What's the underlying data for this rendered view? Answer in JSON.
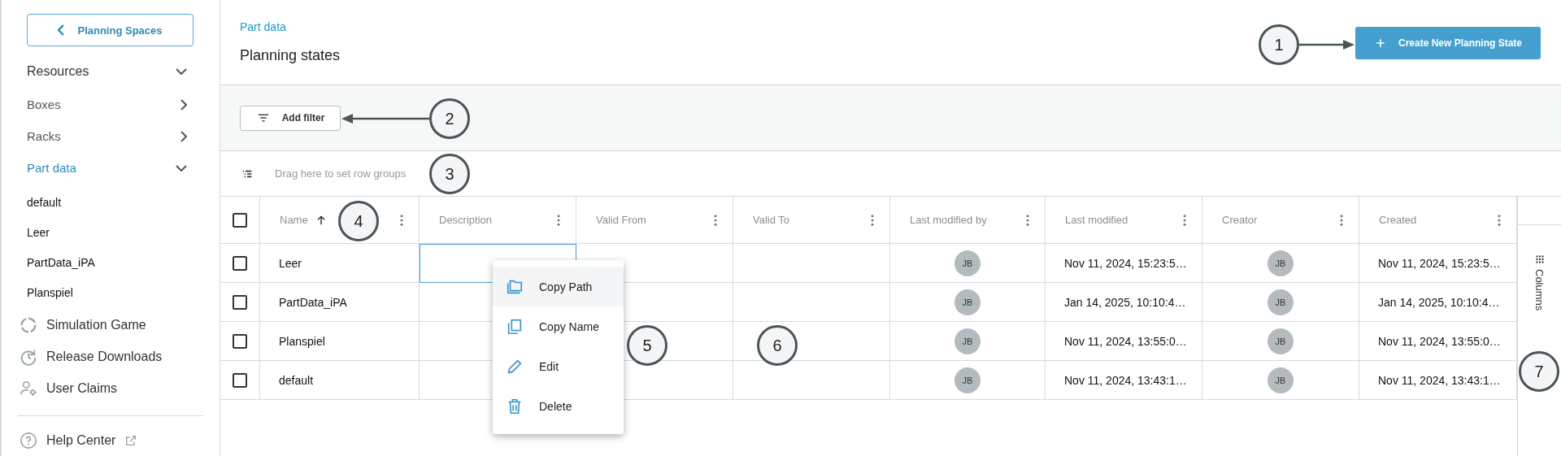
{
  "sidebar": {
    "back_button": "Planning Spaces",
    "nav": [
      {
        "label": "Resources",
        "expanded": true,
        "selected": false,
        "children": [
          {
            "label": "Boxes",
            "expanded": false,
            "selected": false
          },
          {
            "label": "Racks",
            "expanded": false,
            "selected": false
          },
          {
            "label": "Part data",
            "expanded": true,
            "selected": true,
            "children": [
              {
                "label": "default"
              },
              {
                "label": "Leer"
              },
              {
                "label": "PartData_iPA"
              },
              {
                "label": "Planspiel"
              }
            ]
          }
        ]
      }
    ],
    "links": [
      {
        "label": "Simulation Game"
      },
      {
        "label": "Release Downloads"
      },
      {
        "label": "User Claims"
      }
    ],
    "help": {
      "label": "Help Center"
    }
  },
  "header": {
    "breadcrumb": "Part data",
    "title": "Planning states",
    "create_button": "Create New Planning State"
  },
  "filter_bar": {
    "button": "Add filter"
  },
  "group_bar": {
    "placeholder": "Drag here to set row groups"
  },
  "table": {
    "select_all_checked": false,
    "columns": [
      {
        "label": "Name",
        "kind": "text",
        "sorted": true
      },
      {
        "label": "Description",
        "kind": "text",
        "sorted": false
      },
      {
        "label": "Valid From",
        "kind": "text",
        "sorted": false
      },
      {
        "label": "Valid To",
        "kind": "text",
        "sorted": false
      },
      {
        "label": "Last modified by",
        "kind": "avatar",
        "sorted": false
      },
      {
        "label": "Last modified",
        "kind": "text",
        "sorted": false
      },
      {
        "label": "Creator",
        "kind": "avatar",
        "sorted": false
      },
      {
        "label": "Created",
        "kind": "text",
        "sorted": false
      }
    ],
    "rows": [
      {
        "checked": false,
        "cells": [
          {
            "text": "Leer",
            "focused": false
          },
          {
            "focused": true
          },
          {
            "focused": false
          },
          {
            "focused": false
          },
          {
            "text": "JB",
            "focused": false
          },
          {
            "text": "Nov 11, 2024, 15:23:5…",
            "focused": false
          },
          {
            "text": "JB",
            "focused": false
          },
          {
            "text": "Nov 11, 2024, 15:23:5…",
            "focused": false
          }
        ]
      },
      {
        "checked": false,
        "cells": [
          {
            "text": "PartData_iPA",
            "focused": false
          },
          {
            "focused": false
          },
          {
            "focused": false
          },
          {
            "focused": false
          },
          {
            "text": "JB",
            "focused": false
          },
          {
            "text": "Jan 14, 2025, 10:10:4…",
            "focused": false
          },
          {
            "text": "JB",
            "focused": false
          },
          {
            "text": "Jan 14, 2025, 10:10:4…",
            "focused": false
          }
        ]
      },
      {
        "checked": false,
        "cells": [
          {
            "text": "Planspiel",
            "focused": false
          },
          {
            "focused": false
          },
          {
            "focused": false
          },
          {
            "focused": false
          },
          {
            "text": "JB",
            "focused": false
          },
          {
            "text": "Nov 11, 2024, 13:55:0…",
            "focused": false
          },
          {
            "text": "JB",
            "focused": false
          },
          {
            "text": "Nov 11, 2024, 13:55:0…",
            "focused": false
          }
        ]
      },
      {
        "checked": false,
        "cells": [
          {
            "text": "default",
            "focused": false
          },
          {
            "focused": false
          },
          {
            "focused": false
          },
          {
            "focused": false
          },
          {
            "text": "JB",
            "focused": false
          },
          {
            "text": "Nov 11, 2024, 13:43:1…",
            "focused": false
          },
          {
            "text": "JB",
            "focused": false
          },
          {
            "text": "Nov 11, 2024, 13:43:1…",
            "focused": false
          }
        ]
      }
    ]
  },
  "side_panel": {
    "tab": "Columns"
  },
  "context_menu": {
    "items": [
      {
        "label": "Copy Path",
        "hovered": true
      },
      {
        "label": "Copy Name",
        "hovered": false
      },
      {
        "label": "Edit",
        "hovered": false
      },
      {
        "label": "Delete",
        "hovered": false
      }
    ]
  },
  "annotations": [
    {
      "label": "1",
      "arrow": true
    },
    {
      "label": "2",
      "arrow": true
    },
    {
      "label": "3",
      "arrow": false
    },
    {
      "label": "4",
      "arrow": false
    },
    {
      "label": "5",
      "arrow": false
    },
    {
      "label": "6",
      "arrow": false
    },
    {
      "label": "7",
      "arrow": false
    }
  ]
}
